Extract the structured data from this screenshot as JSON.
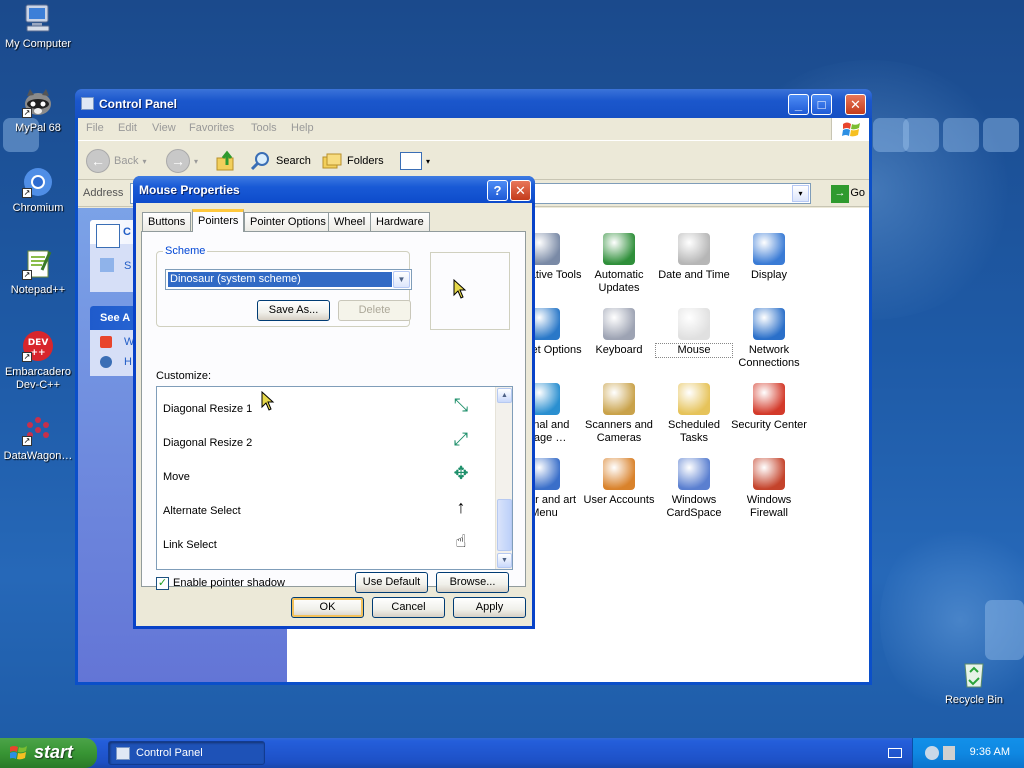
{
  "desktop": {
    "icons": [
      {
        "label": "My Computer",
        "icon": "my-computer-icon"
      },
      {
        "label": "MyPal 68",
        "icon": "mypal-raccoon-icon"
      },
      {
        "label": "Chromium",
        "icon": "chromium-icon"
      },
      {
        "label": "Notepad++",
        "icon": "notepad-plus-plus-icon"
      },
      {
        "label": "Embarcadero Dev-C++",
        "icon": "devcpp-icon",
        "badge": "DEV ++"
      },
      {
        "label": "DataWagon…",
        "icon": "datawagon-icon"
      },
      {
        "label": "Recycle Bin",
        "icon": "recycle-bin-icon"
      }
    ]
  },
  "control_panel": {
    "title": "Control Panel",
    "menu": [
      "File",
      "Edit",
      "View",
      "Favorites",
      "Tools",
      "Help"
    ],
    "toolbar": {
      "back": "Back",
      "search": "Search",
      "folders": "Folders"
    },
    "address_label": "Address",
    "go_label": "Go",
    "left_panel": {
      "box1_partial": "C",
      "box1_item_partial": "S",
      "see_also_partial": "See A",
      "item1_partial": "W",
      "item2_partial": "H"
    },
    "items": [
      {
        "label": "inistrative Tools",
        "icon": "administrative-tools-icon",
        "color": "#7a8aa6"
      },
      {
        "label": "Automatic Updates",
        "icon": "automatic-updates-icon",
        "color": "#2f8f3a"
      },
      {
        "label": "Date and Time",
        "icon": "date-time-icon",
        "color": "#b6b6b6"
      },
      {
        "label": "Display",
        "icon": "display-icon",
        "color": "#3a7bd5"
      },
      {
        "label": "nternet Options",
        "icon": "internet-options-icon",
        "color": "#2a78c8"
      },
      {
        "label": "Keyboard",
        "icon": "keyboard-icon",
        "color": "#9da3b3"
      },
      {
        "label": "Mouse",
        "icon": "mouse-icon",
        "color": "#e0e0e0"
      },
      {
        "label": "Network Connections",
        "icon": "network-connections-icon",
        "color": "#2a6fc9"
      },
      {
        "label": "gional and guage …",
        "icon": "regional-language-icon",
        "color": "#2a8fd0"
      },
      {
        "label": "Scanners and Cameras",
        "icon": "scanners-cameras-icon",
        "color": "#c9a24a"
      },
      {
        "label": "Scheduled Tasks",
        "icon": "scheduled-tasks-icon",
        "color": "#e6c35a"
      },
      {
        "label": "Security Center",
        "icon": "security-center-icon",
        "color": "#d33a2a"
      },
      {
        "label": "skbar and art Menu",
        "icon": "taskbar-start-menu-icon",
        "color": "#3a6fc9"
      },
      {
        "label": "User Accounts",
        "icon": "user-accounts-icon",
        "color": "#d9822b"
      },
      {
        "label": "Windows CardSpace",
        "icon": "windows-cardspace-icon",
        "color": "#5a7fd0"
      },
      {
        "label": "Windows Firewall",
        "icon": "windows-firewall-icon",
        "color": "#c4432b"
      }
    ]
  },
  "dialog": {
    "title": "Mouse Properties",
    "help": "?",
    "close": "✕",
    "tabs": [
      "Buttons",
      "Pointers",
      "Pointer Options",
      "Wheel",
      "Hardware"
    ],
    "active_tab": "Pointers",
    "scheme_legend": "Scheme",
    "scheme_value": "Dinosaur (system scheme)",
    "save_as": "Save As...",
    "delete": "Delete",
    "customize_label": "Customize:",
    "cursors": [
      {
        "name": "Diagonal Resize 1",
        "glyph": "⤡",
        "icon": "diagonal-resize-1-icon"
      },
      {
        "name": "Diagonal Resize 2",
        "glyph": "⤢",
        "icon": "diagonal-resize-2-icon"
      },
      {
        "name": "Move",
        "glyph": "✥",
        "icon": "move-icon"
      },
      {
        "name": "Alternate Select",
        "glyph": "↑",
        "icon": "alternate-select-icon"
      },
      {
        "name": "Link Select",
        "glyph": "☝",
        "icon": "link-select-icon"
      }
    ],
    "enable_shadow": "Enable pointer shadow",
    "enable_shadow_checked": true,
    "use_default": "Use Default",
    "browse": "Browse...",
    "ok": "OK",
    "cancel": "Cancel",
    "apply": "Apply"
  },
  "taskbar": {
    "start": "start",
    "task": "Control Panel",
    "clock": "9:36 AM"
  },
  "colors": {
    "xp_blue": "#0842c8",
    "dialog_face": "#ece9d8",
    "start_green": "#389534",
    "tray_blue": "#0f88e2"
  }
}
